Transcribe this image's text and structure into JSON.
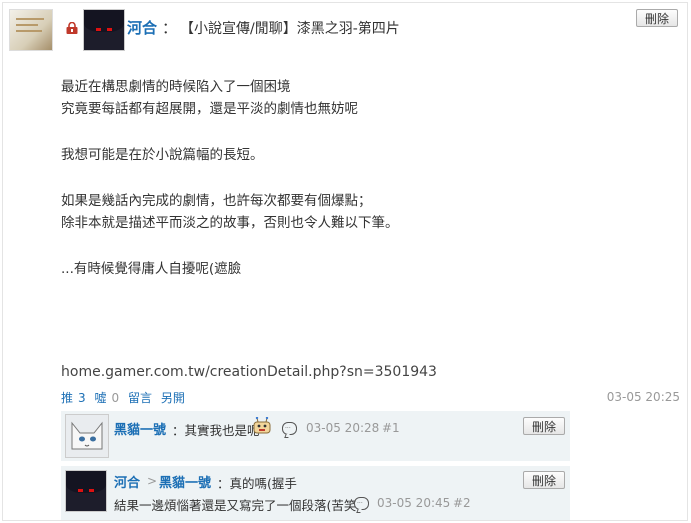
{
  "post": {
    "author": "河合",
    "colon": "：",
    "title": "【小說宣傳/閒聊】漆黑之羽-第四片",
    "delete_label": "刪除",
    "body": {
      "p1": "最近在構思劇情的時候陷入了一個困境",
      "p2": "究竟要每話都有超展開，還是平淡的劇情也無妨呢",
      "p3": "我想可能是在於小說篇幅的長短。",
      "p4": "如果是幾話內完成的劇情，也許每次都要有個爆點；",
      "p5": "除非本就是描述平而淡之的故事，否則也令人難以下筆。",
      "p6": "...有時候覺得庸人自擾呢(遮臉"
    },
    "link": "home.gamer.com.tw/creationDetail.php?sn=3501943",
    "actions": {
      "push_label": "推",
      "push_count": "3",
      "boo_label": "噓",
      "boo_count": "0",
      "comment_label": "留言",
      "share_label": "另開"
    },
    "timestamp": "03-05 20:25"
  },
  "comments": [
    {
      "name": "黑貓一號",
      "text": "：其實我也是呢",
      "meta": "03-05 20:28",
      "floor": "#1",
      "delete_label": "刪除"
    },
    {
      "name": "河合",
      "arrow": ">",
      "reply_to": "黑貓一號",
      "text": "：真的嗎(握手",
      "text2": "結果一邊煩惱著還是又寫完了一個段落(苦笑",
      "meta": "03-05 20:45",
      "floor": "#2",
      "delete_label": "刪除"
    }
  ],
  "colors": {
    "link_blue": "#1c6fb5",
    "meta_gray": "#999999",
    "comment_bg": "#eef3f5"
  },
  "icons": {
    "lock": "lock-icon",
    "speech": "speech-bubble-icon",
    "emoticon": "robot-emoticon"
  }
}
